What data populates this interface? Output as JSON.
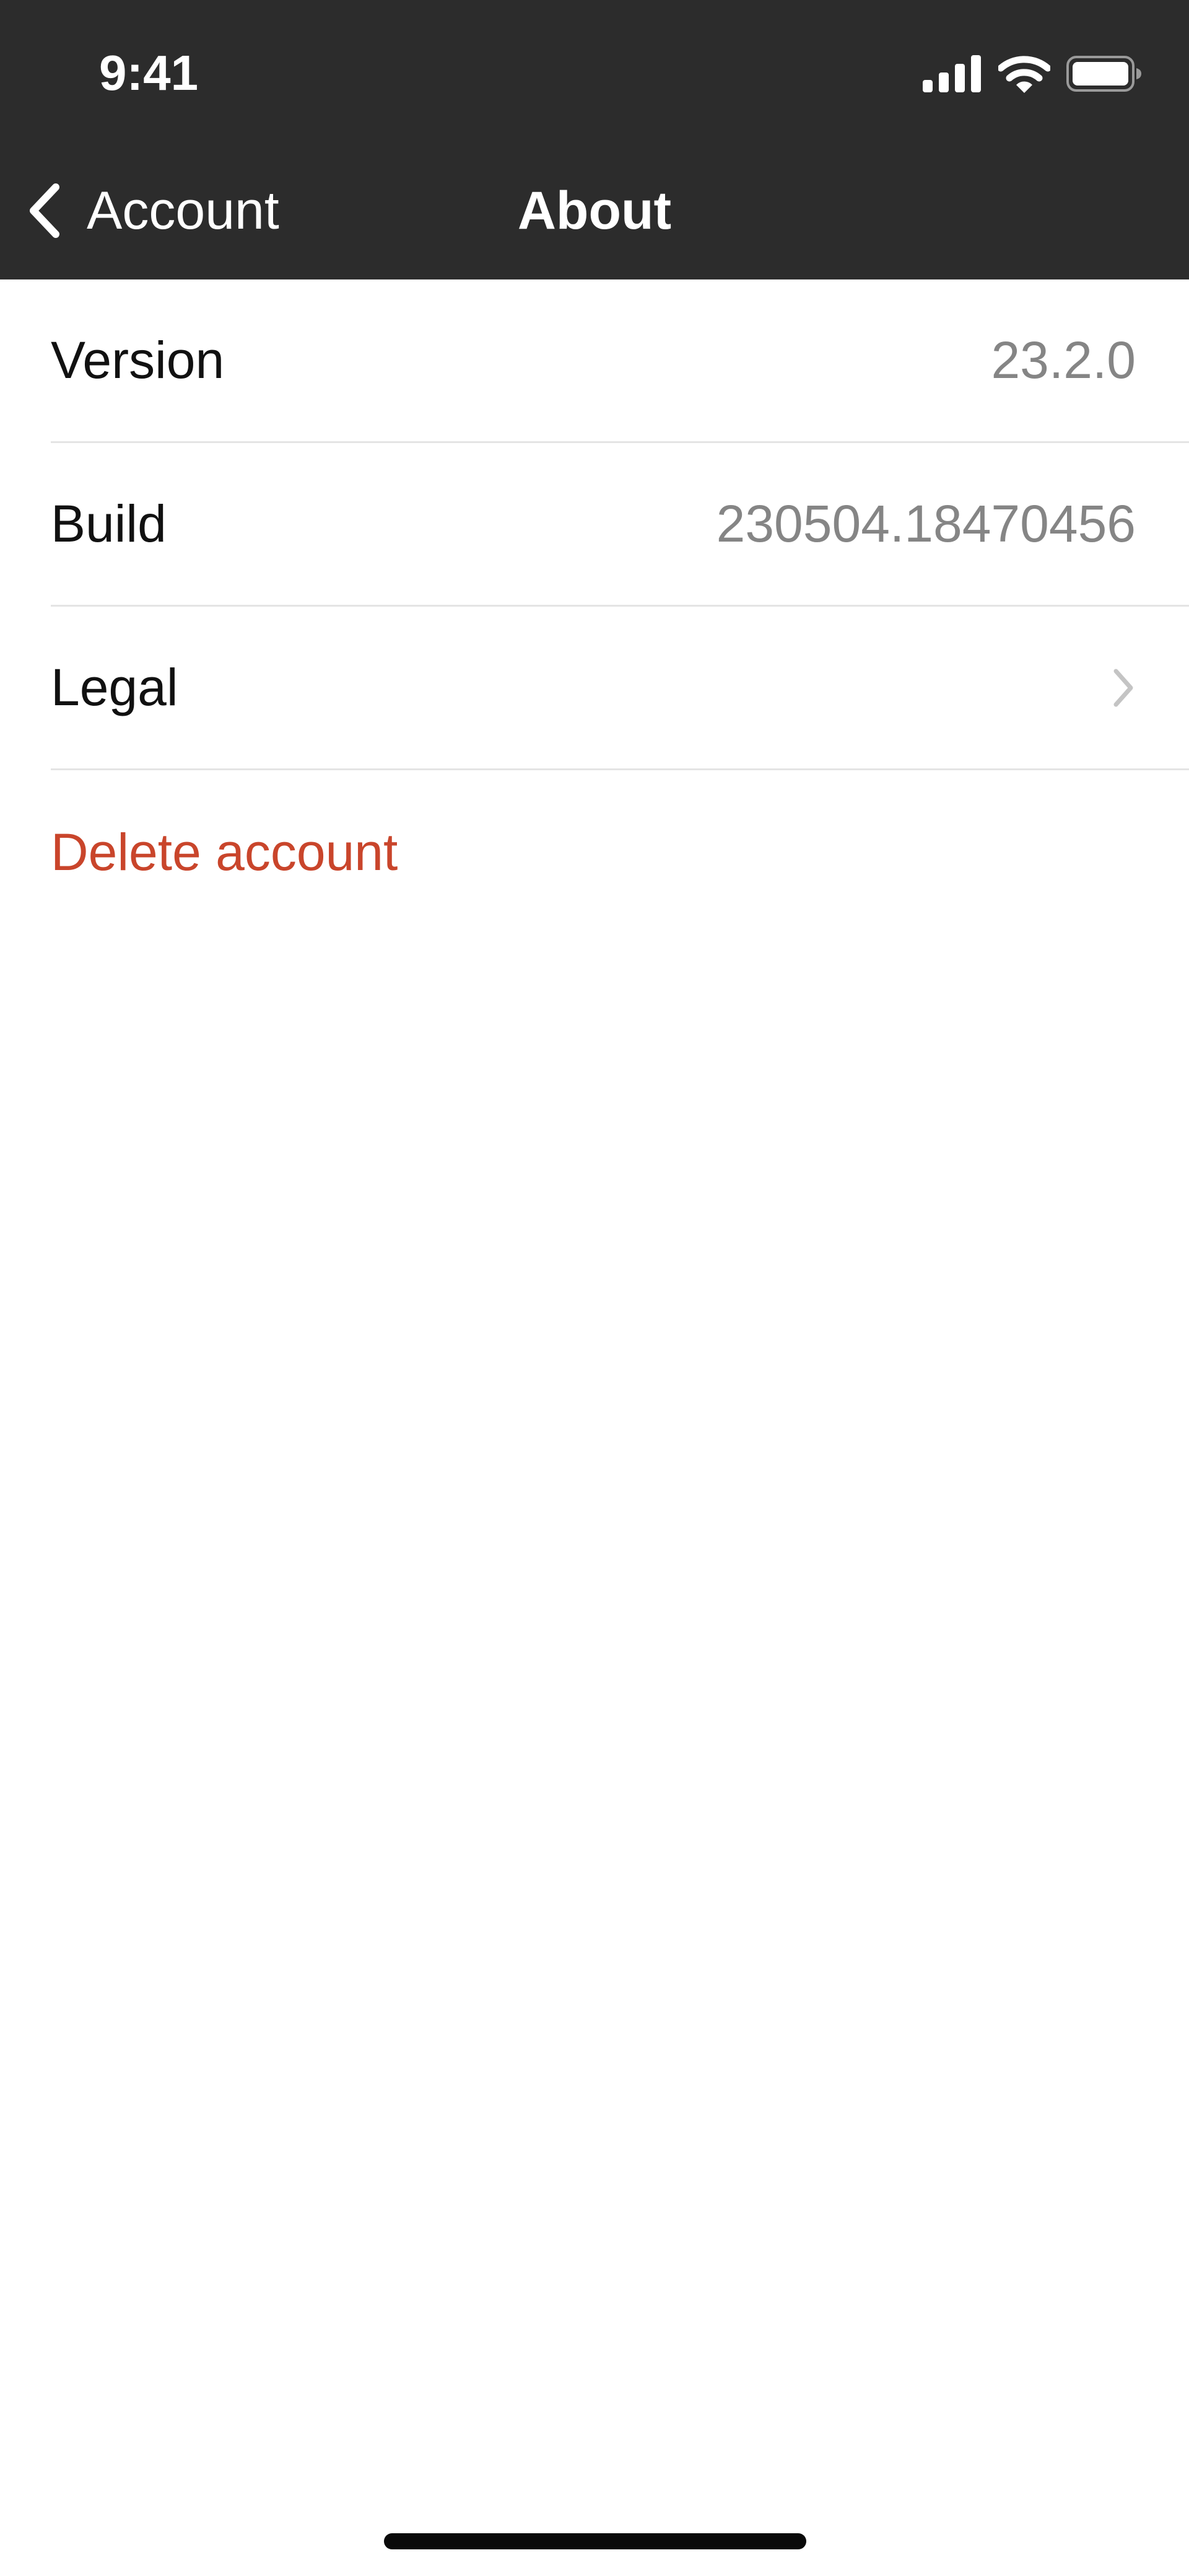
{
  "status_bar": {
    "time": "9:41",
    "icons": [
      "signal-icon",
      "wifi-icon",
      "battery-icon"
    ]
  },
  "nav_bar": {
    "back_label": "Account",
    "back_icon": "chevron-left-icon",
    "title": "About"
  },
  "about_rows": [
    {
      "label": "Version",
      "value": "23.2.0"
    },
    {
      "label": "Build",
      "value": "230504.18470456"
    },
    {
      "label": "Legal",
      "icon": "chevron-right-icon"
    }
  ],
  "delete_account": {
    "label": "Delete account",
    "color": "#c9452b"
  },
  "colors": {
    "header_background": "#2c2c2c",
    "value_text": "#858585",
    "divider": "#e4e4e4"
  }
}
